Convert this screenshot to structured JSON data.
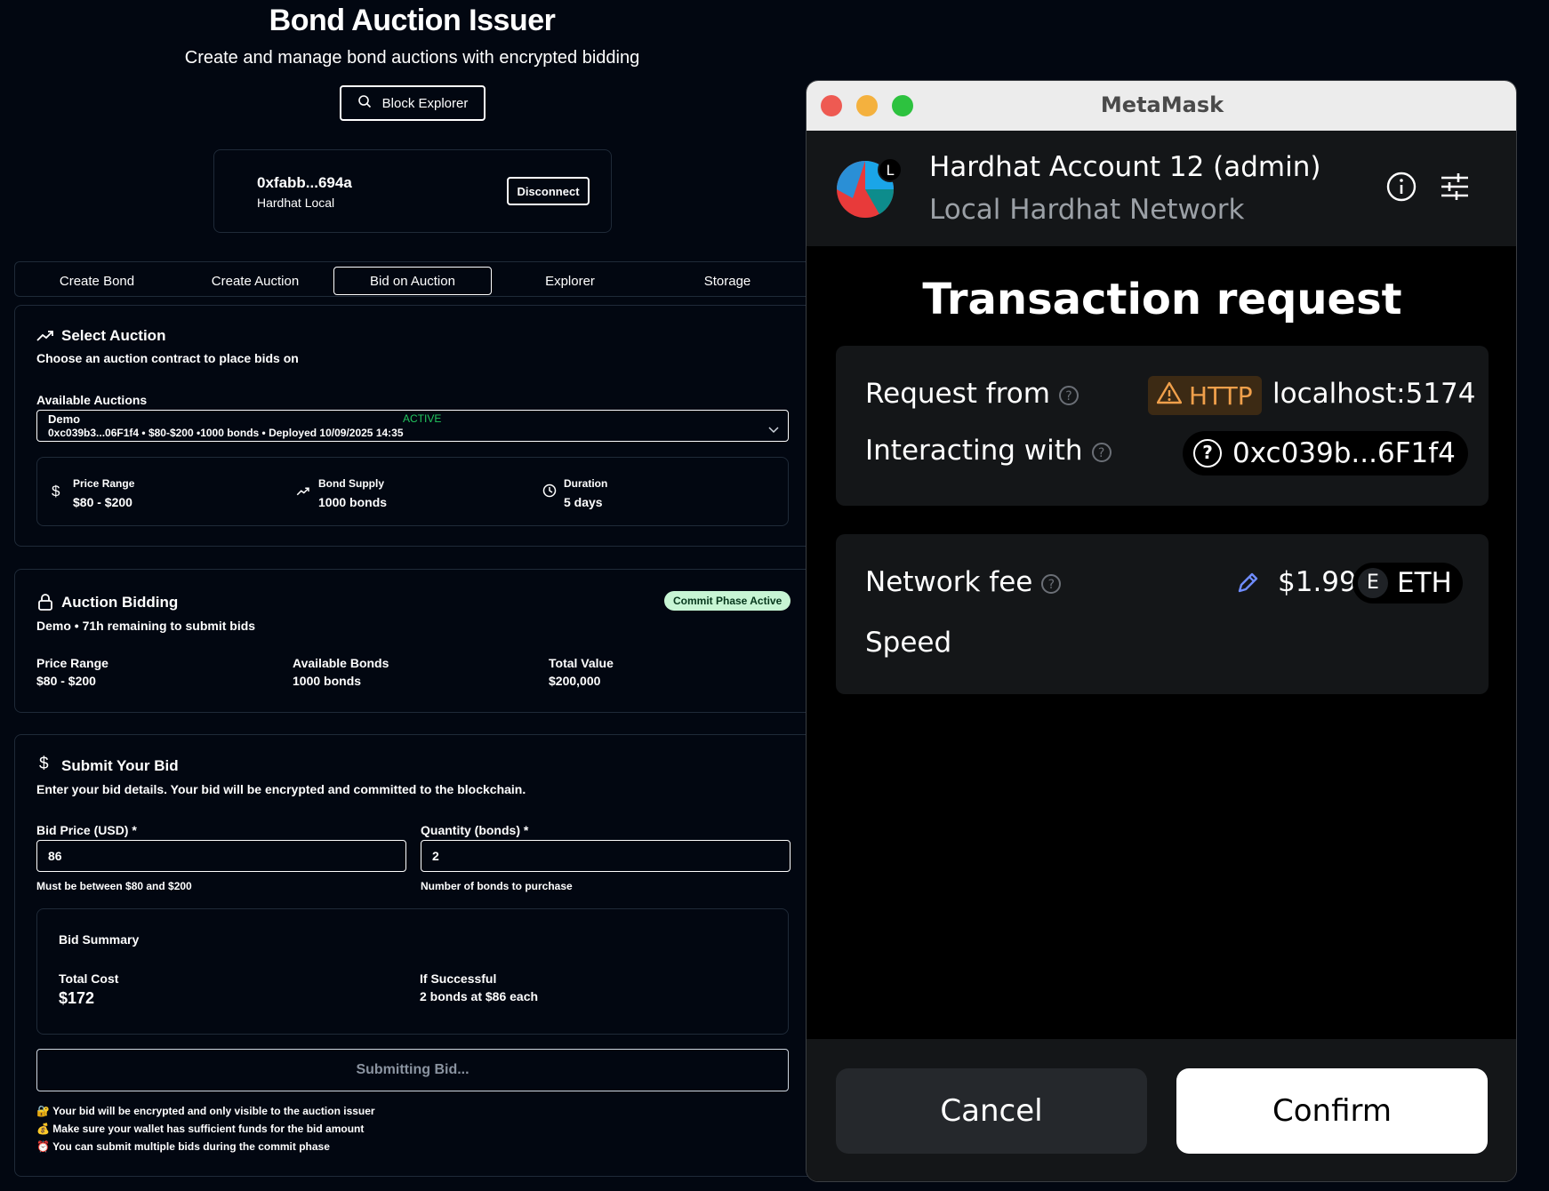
{
  "app": {
    "title": "Bond Auction Issuer",
    "subtitle": "Create and manage bond auctions with encrypted bidding",
    "block_explorer_label": "Block Explorer"
  },
  "wallet": {
    "address": "0xfabb...694a",
    "network": "Hardhat Local",
    "disconnect_label": "Disconnect"
  },
  "tabs": [
    {
      "label": "Create Bond"
    },
    {
      "label": "Create Auction"
    },
    {
      "label": "Bid on Auction",
      "active": true
    },
    {
      "label": "Explorer"
    },
    {
      "label": "Storage"
    }
  ],
  "select_auction": {
    "title": "Select Auction",
    "description": "Choose an auction contract to place bids on",
    "field_label": "Available Auctions",
    "selected_name": "Demo",
    "selected_status": "ACTIVE",
    "selected_detail": "0xc039b3...06F1f4 • $80-$200 •1000 bonds • Deployed 10/09/2025 14:35",
    "stats": [
      {
        "label": "Price Range",
        "value": "$80 - $200",
        "icon": "dollar-icon"
      },
      {
        "label": "Bond Supply",
        "value": "1000 bonds",
        "icon": "trending-up-icon"
      },
      {
        "label": "Duration",
        "value": "5 days",
        "icon": "clock-icon"
      }
    ]
  },
  "auction_bidding": {
    "title": "Auction Bidding",
    "badge": "Commit Phase Active",
    "subtitle": "Demo • 71h remaining to submit bids",
    "stats": [
      {
        "label": "Price Range",
        "value": "$80 - $200"
      },
      {
        "label": "Available Bonds",
        "value": "1000 bonds"
      },
      {
        "label": "Total Value",
        "value": "$200,000"
      }
    ]
  },
  "submit_bid": {
    "title": "Submit Your Bid",
    "description": "Enter your bid details. Your bid will be encrypted and committed to the blockchain.",
    "price_label": "Bid Price (USD) *",
    "price_value": "86",
    "price_hint": "Must be between $80 and $200",
    "quantity_label": "Quantity (bonds) *",
    "quantity_value": "2",
    "quantity_hint": "Number of bonds to purchase",
    "summary_title": "Bid Summary",
    "total_cost_label": "Total Cost",
    "total_cost_value": "$172",
    "if_successful_label": "If Successful",
    "if_successful_value": "2 bonds at $86 each",
    "submit_label": "Submitting Bid...",
    "notes": [
      {
        "emoji": "🔐",
        "text": "Your bid will be encrypted and only visible to the auction issuer"
      },
      {
        "emoji": "💰",
        "text": "Make sure your wallet has sufficient funds for the bid amount"
      },
      {
        "emoji": "⏰",
        "text": "You can submit multiple bids during the commit phase"
      }
    ]
  },
  "metamask": {
    "window_title": "MetaMask",
    "account_badge": "L",
    "account_name": "Hardhat Account 12 (admin)",
    "network_name": "Local Hardhat Network",
    "heading": "Transaction request",
    "request_from_label": "Request from",
    "http_badge": "HTTP",
    "request_from_value": "localhost:5174",
    "interacting_label": "Interacting with",
    "interacting_value": "0xc039b...6F1f4",
    "network_fee_label": "Network fee",
    "network_fee_value": "$1.99",
    "token_letter": "E",
    "token_symbol": "ETH",
    "speed_label": "Speed",
    "cancel_label": "Cancel",
    "confirm_label": "Confirm"
  },
  "colors": {
    "page_bg": "#020711",
    "accent_green": "#22c55e",
    "badge_bg": "#c7f5d4",
    "metamask_bg": "#000000",
    "metamask_panel": "#141618",
    "http_warning": "#f0a04b",
    "pencil_blue": "#6f8cff"
  }
}
